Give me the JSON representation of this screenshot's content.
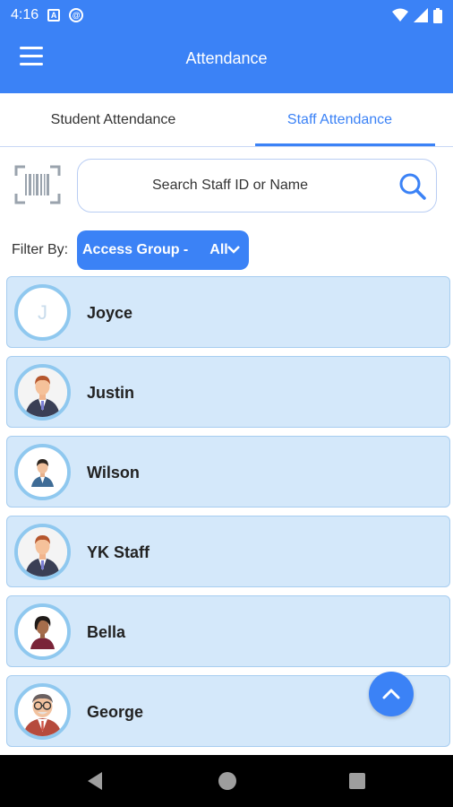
{
  "status_bar": {
    "time": "4:16",
    "icons": [
      "a-box-icon",
      "at-circle-icon",
      "wifi-icon",
      "cell-signal-icon",
      "battery-icon"
    ]
  },
  "header": {
    "title": "Attendance",
    "menu_icon": "hamburger-menu-icon"
  },
  "tabs": [
    {
      "label": "Student Attendance",
      "active": false
    },
    {
      "label": "Staff Attendance",
      "active": true
    }
  ],
  "search": {
    "placeholder": "Search Staff ID or Name",
    "value": "",
    "barcode_icon": "barcode-scan-icon",
    "search_icon": "search-icon"
  },
  "filter": {
    "label": "Filter By:",
    "select_prefix": "Access Group -",
    "select_value": "All"
  },
  "staff": [
    {
      "name": "Joyce",
      "avatar": "letter",
      "initial": "J"
    },
    {
      "name": "Justin",
      "avatar": "man-suit-icon"
    },
    {
      "name": "Wilson",
      "avatar": "man-small-icon"
    },
    {
      "name": "YK Staff",
      "avatar": "man-suit-icon"
    },
    {
      "name": "Bella",
      "avatar": "woman-icon"
    },
    {
      "name": "George",
      "avatar": "man-glasses-icon"
    }
  ],
  "fab_icon": "chevron-up-icon",
  "colors": {
    "primary": "#3b82f6",
    "list_item_bg": "#d4e8fa",
    "avatar_ring": "#8fc8ef"
  }
}
